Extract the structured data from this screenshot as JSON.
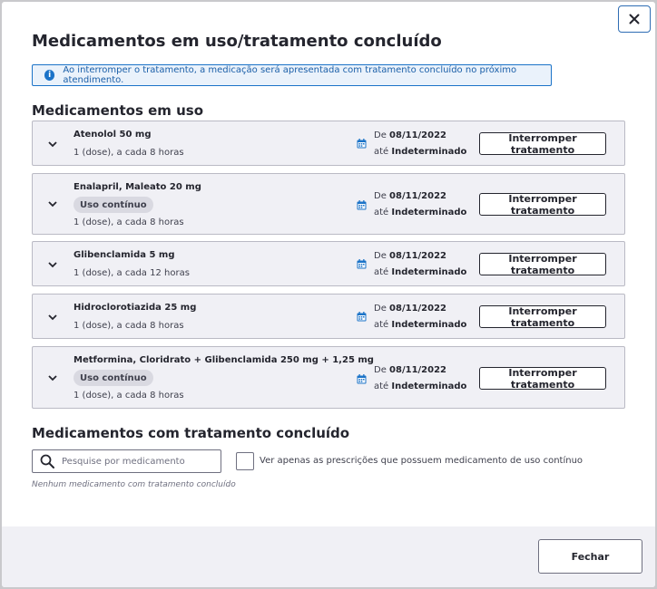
{
  "modal": {
    "title": "Medicamentos em uso/tratamento concluído",
    "alert": "Ao interromper o tratamento, a medicação será apresentada com tratamento concluído no próximo atendimento."
  },
  "in_use": {
    "section_title": "Medicamentos em uso",
    "items": [
      {
        "name": "Atenolol 50 mg",
        "badge": "",
        "dose": "1 (dose), a cada 8 horas",
        "date_from_prefix": "De",
        "date_from": "08/11/2022",
        "date_to_prefix": "até",
        "date_to": "Indeterminado",
        "action": "Interromper tratamento"
      },
      {
        "name": "Enalapril, Maleato 20 mg",
        "badge": "Uso contínuo",
        "dose": "1 (dose), a cada 8 horas",
        "date_from_prefix": "De",
        "date_from": "08/11/2022",
        "date_to_prefix": "até",
        "date_to": "Indeterminado",
        "action": "Interromper tratamento"
      },
      {
        "name": "Glibenclamida 5 mg",
        "badge": "",
        "dose": "1 (dose), a cada 12 horas",
        "date_from_prefix": "De",
        "date_from": "08/11/2022",
        "date_to_prefix": "até",
        "date_to": "Indeterminado",
        "action": "Interromper tratamento"
      },
      {
        "name": "Hidroclorotiazida 25 mg",
        "badge": "",
        "dose": "1 (dose), a cada 8 horas",
        "date_from_prefix": "De",
        "date_from": "08/11/2022",
        "date_to_prefix": "até",
        "date_to": "Indeterminado",
        "action": "Interromper tratamento"
      },
      {
        "name": "Metformina, Cloridrato + Glibenclamida 250 mg + 1,25 mg",
        "badge": "Uso contínuo",
        "dose": "1 (dose), a cada 8 horas",
        "date_from_prefix": "De",
        "date_from": "08/11/2022",
        "date_to_prefix": "até",
        "date_to": "Indeterminado",
        "action": "Interromper tratamento"
      }
    ]
  },
  "completed": {
    "section_title": "Medicamentos com tratamento concluído",
    "search_placeholder": "Pesquise por medicamento",
    "search_value": "",
    "checkbox_label": "Ver apenas as prescrições que possuem medicamento de uso contínuo",
    "checkbox_checked": false,
    "empty_message": "Nenhum medicamento com tratamento concluído"
  },
  "footer": {
    "close_label": "Fechar"
  },
  "icons": {
    "close": "close-icon",
    "info": "info-icon",
    "chevron": "chevron-down-icon",
    "calendar": "calendar-icon",
    "search": "search-icon"
  },
  "colors": {
    "primary": "#1b73c8",
    "card_bg": "#f0f0f5",
    "text": "#24252e",
    "badge_bg": "#d9d9e1"
  }
}
